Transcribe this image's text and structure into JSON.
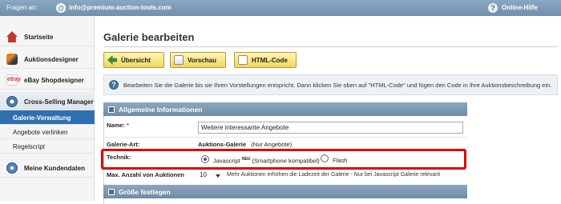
{
  "topbar": {
    "ask_label": "Fragen an:",
    "email": "info@premium-auction-tools.com",
    "help_label": "Online-Hilfe"
  },
  "sidebar": {
    "items": [
      {
        "label": "Startseite",
        "icon": "home-icon"
      },
      {
        "label": "Auktionsdesigner",
        "icon": "brush-icon"
      },
      {
        "label": "eBay Shopdesigner",
        "icon": "ebay-icon"
      },
      {
        "label": "Cross-Selling Manager",
        "icon": "crossselling-icon"
      },
      {
        "label": "Meine Kundendaten",
        "icon": "customer-icon"
      }
    ],
    "subitems": [
      {
        "label": "Galerie-Verwaltung"
      },
      {
        "label": "Angebote verlinken"
      },
      {
        "label": "Regelscript"
      }
    ],
    "ebay_icon_text": "eBay"
  },
  "main": {
    "title": "Galerie bearbeiten",
    "buttons": {
      "overview": "Übersicht",
      "preview": "Vorschau",
      "html_code": "HTML-Code"
    },
    "info_text": "Bearbeiten Sie die Galerie bis sie Ihren Vorstellungen entspricht. Dann klicken Sie oben auf \"HTML-Code\" und fügen den Code in Ihre Auktionsbeschreibung ein.",
    "section_general": "Allgemeine Informationen",
    "section_size": "Größe festlegen",
    "name_label": "Name:",
    "name_required": "*",
    "name_value": "Weitere interessante Angebote",
    "gallery_type_label": "Galerie-Art:",
    "gallery_type_value": "Auktions-Galerie",
    "gallery_type_note": "(Nur Angebote)",
    "technique_label": "Technik:",
    "technique_options": [
      {
        "label": "Javascript",
        "badge": "NEU",
        "note": "(Smartphone kompatibel)",
        "selected": true
      },
      {
        "label": "Flash",
        "selected": false
      }
    ],
    "max_auctions_label": "Max. Anzahl von Auktionen",
    "max_auctions_value": "10",
    "max_auctions_note": "Mehr Auktionen erhöhen die Ladezeit der Galerie - Nur bei Javascript Galerie relevant"
  },
  "colors": {
    "highlight": "#e00000",
    "active_nav": "#2f6fb0",
    "button_bg": "#f0d65a",
    "section_bg": "#7d97b1"
  }
}
